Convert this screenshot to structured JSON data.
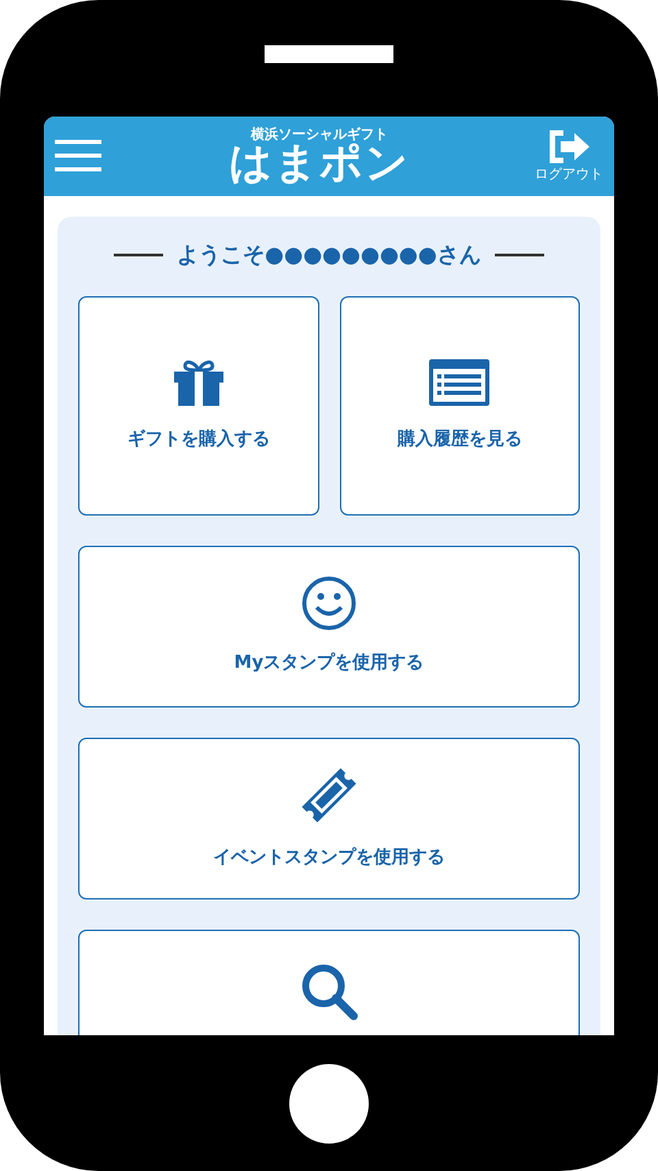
{
  "header": {
    "tagline": "横浜ソーシャルギフト",
    "logo": "はまポン",
    "logout": "ログアウト"
  },
  "welcome": "ようこそ●●●●●●●●●さん",
  "menu": [
    {
      "kind": "gift",
      "label": "ギフトを購入する",
      "wide": false
    },
    {
      "kind": "history",
      "label": "購入履歴を見る",
      "wide": false
    },
    {
      "kind": "smile",
      "label": "Myスタンプを使用する",
      "wide": true
    },
    {
      "kind": "ticket",
      "label": "イベントスタンプを使用する",
      "wide": true
    },
    {
      "kind": "search",
      "wide": true
    }
  ]
}
